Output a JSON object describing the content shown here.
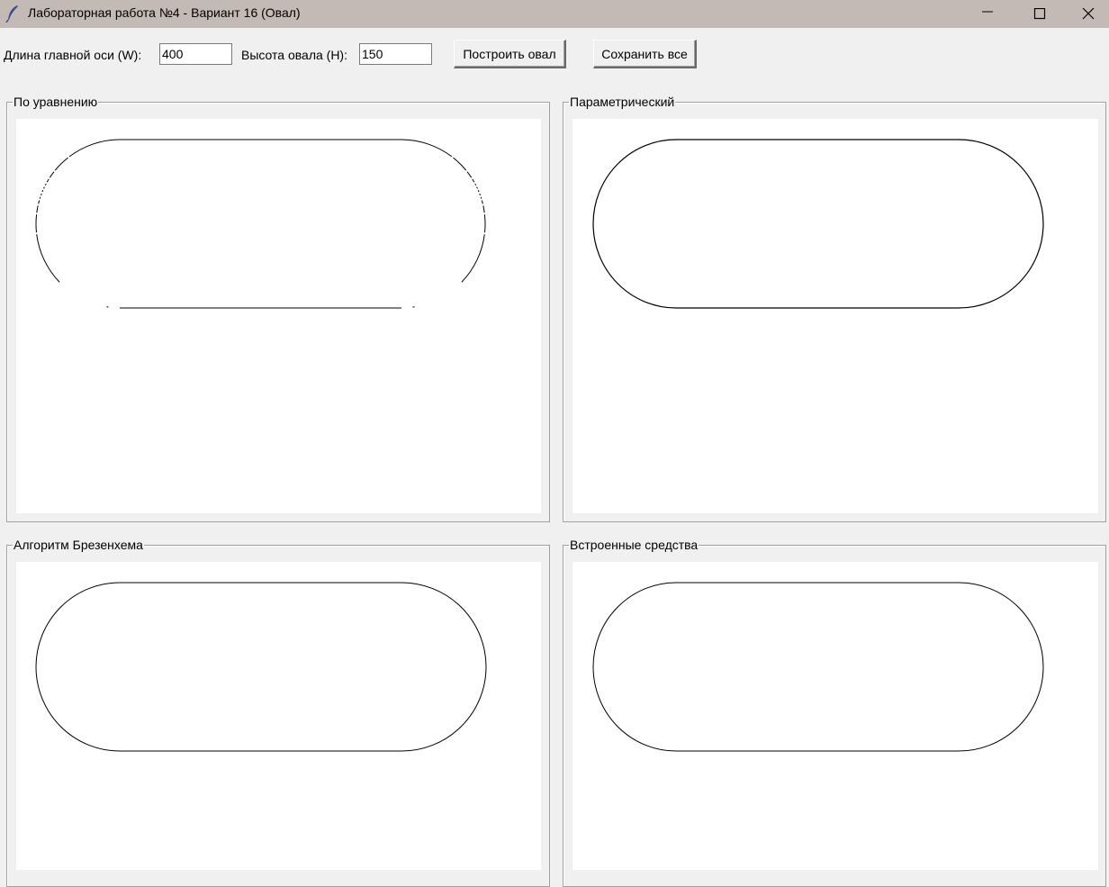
{
  "window": {
    "title": "Лабораторная работа №4 - Вариант 16 (Овал)",
    "icon": "feather-icon",
    "controls": [
      "minimize-icon",
      "maximize-icon",
      "close-icon"
    ]
  },
  "toolbar": {
    "width_label": "Длина главной оси (W):",
    "width_value": "400",
    "height_label": "Высота овала (H):",
    "height_value": "150",
    "build_button": "Построить овал",
    "save_button": "Сохранить все"
  },
  "panels": [
    {
      "label": "По уравнению",
      "style": "dotted-sides"
    },
    {
      "label": "Параметрический",
      "style": "solid"
    },
    {
      "label": "Алгоритм Брезенхема",
      "style": "solid"
    },
    {
      "label": "Встроенные средства",
      "style": "solid"
    }
  ],
  "oval": {
    "W": 400,
    "H": 150
  },
  "colors": {
    "titlebar": "#c3bab6",
    "window_bg": "#f0f0f0",
    "canvas_bg": "#ffffff",
    "stroke": "#000000"
  }
}
